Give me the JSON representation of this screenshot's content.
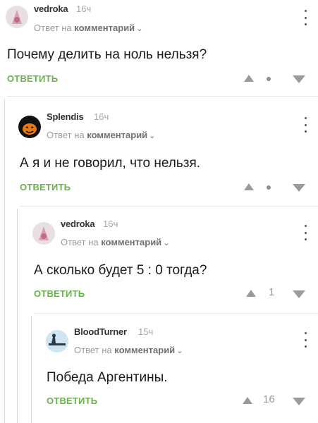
{
  "comments": [
    {
      "author": "vedroka",
      "time": "16ч",
      "reply_prefix": "Ответ на",
      "reply_target": "комментарий",
      "text": "Почему делить на ноль нельзя?",
      "reply_label": "ОТВЕТИТЬ",
      "score": ""
    },
    {
      "author": "Splendis",
      "time": "16ч",
      "reply_prefix": "Ответ на",
      "reply_target": "комментарий",
      "text": "А я и не говорил, что нельзя.",
      "reply_label": "ОТВЕТИТЬ",
      "score": ""
    },
    {
      "author": "vedroka",
      "time": "16ч",
      "reply_prefix": "Ответ на",
      "reply_target": "комментарий",
      "text": "А сколько будет 5 : 0 тогда?",
      "reply_label": "ОТВЕТИТЬ",
      "score": "1"
    },
    {
      "author": "BloodTurner",
      "time": "15ч",
      "reply_prefix": "Ответ на",
      "reply_target": "комментарий",
      "text": "Победа Аргентины.",
      "reply_label": "ОТВЕТИТЬ",
      "score": "16"
    }
  ],
  "icons": {
    "menu": "more-vertical-icon",
    "upvote": "triangle-up-icon",
    "downvote": "triangle-down-icon",
    "chevron": "chevron-down-icon"
  },
  "colors": {
    "reply_button": "#6ab04c",
    "muted": "#a6a6a6",
    "vote": "#9a9a9a"
  }
}
